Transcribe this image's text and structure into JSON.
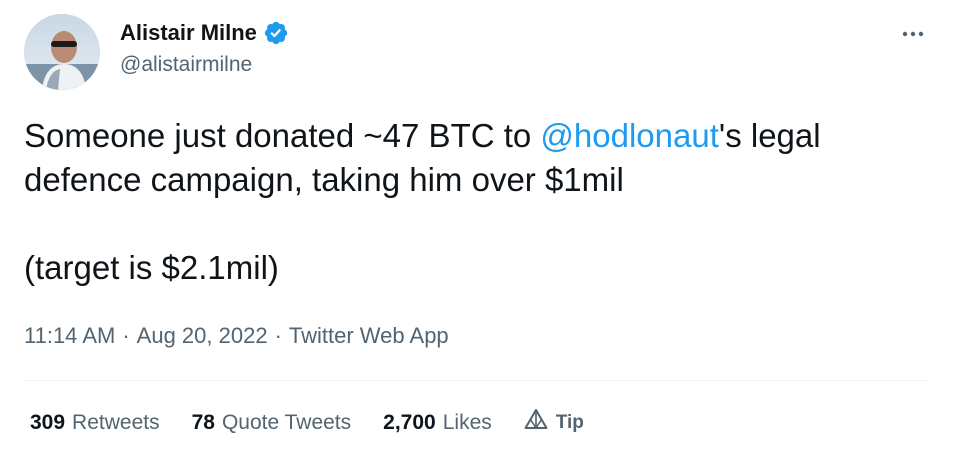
{
  "author": {
    "display_name": "Alistair Milne",
    "handle": "@alistairmilne",
    "verified": true,
    "avatar_icon": "user-avatar"
  },
  "tweet": {
    "line1_before": "Someone just donated ~47 BTC to ",
    "mention": "@hodlonaut",
    "line1_after": "'s legal",
    "line2": "defence campaign, taking him over $1mil",
    "line3": "(target is $2.1mil)"
  },
  "meta": {
    "time": "11:14 AM",
    "date": "Aug 20, 2022",
    "source": "Twitter Web App",
    "separator": "·"
  },
  "stats": {
    "retweets_count": "309",
    "retweets_label": "Retweets",
    "quotes_count": "78",
    "quotes_label": "Quote Tweets",
    "likes_count": "2,700",
    "likes_label": "Likes",
    "tip_label": "Tip"
  },
  "colors": {
    "accent": "#1d9bf0",
    "text_primary": "#0f1419",
    "text_secondary": "#536471",
    "divider": "#eff3f4"
  },
  "icons": {
    "verified": "verified-badge-icon",
    "more": "more-horizontal-icon",
    "tip": "tip-icon"
  }
}
